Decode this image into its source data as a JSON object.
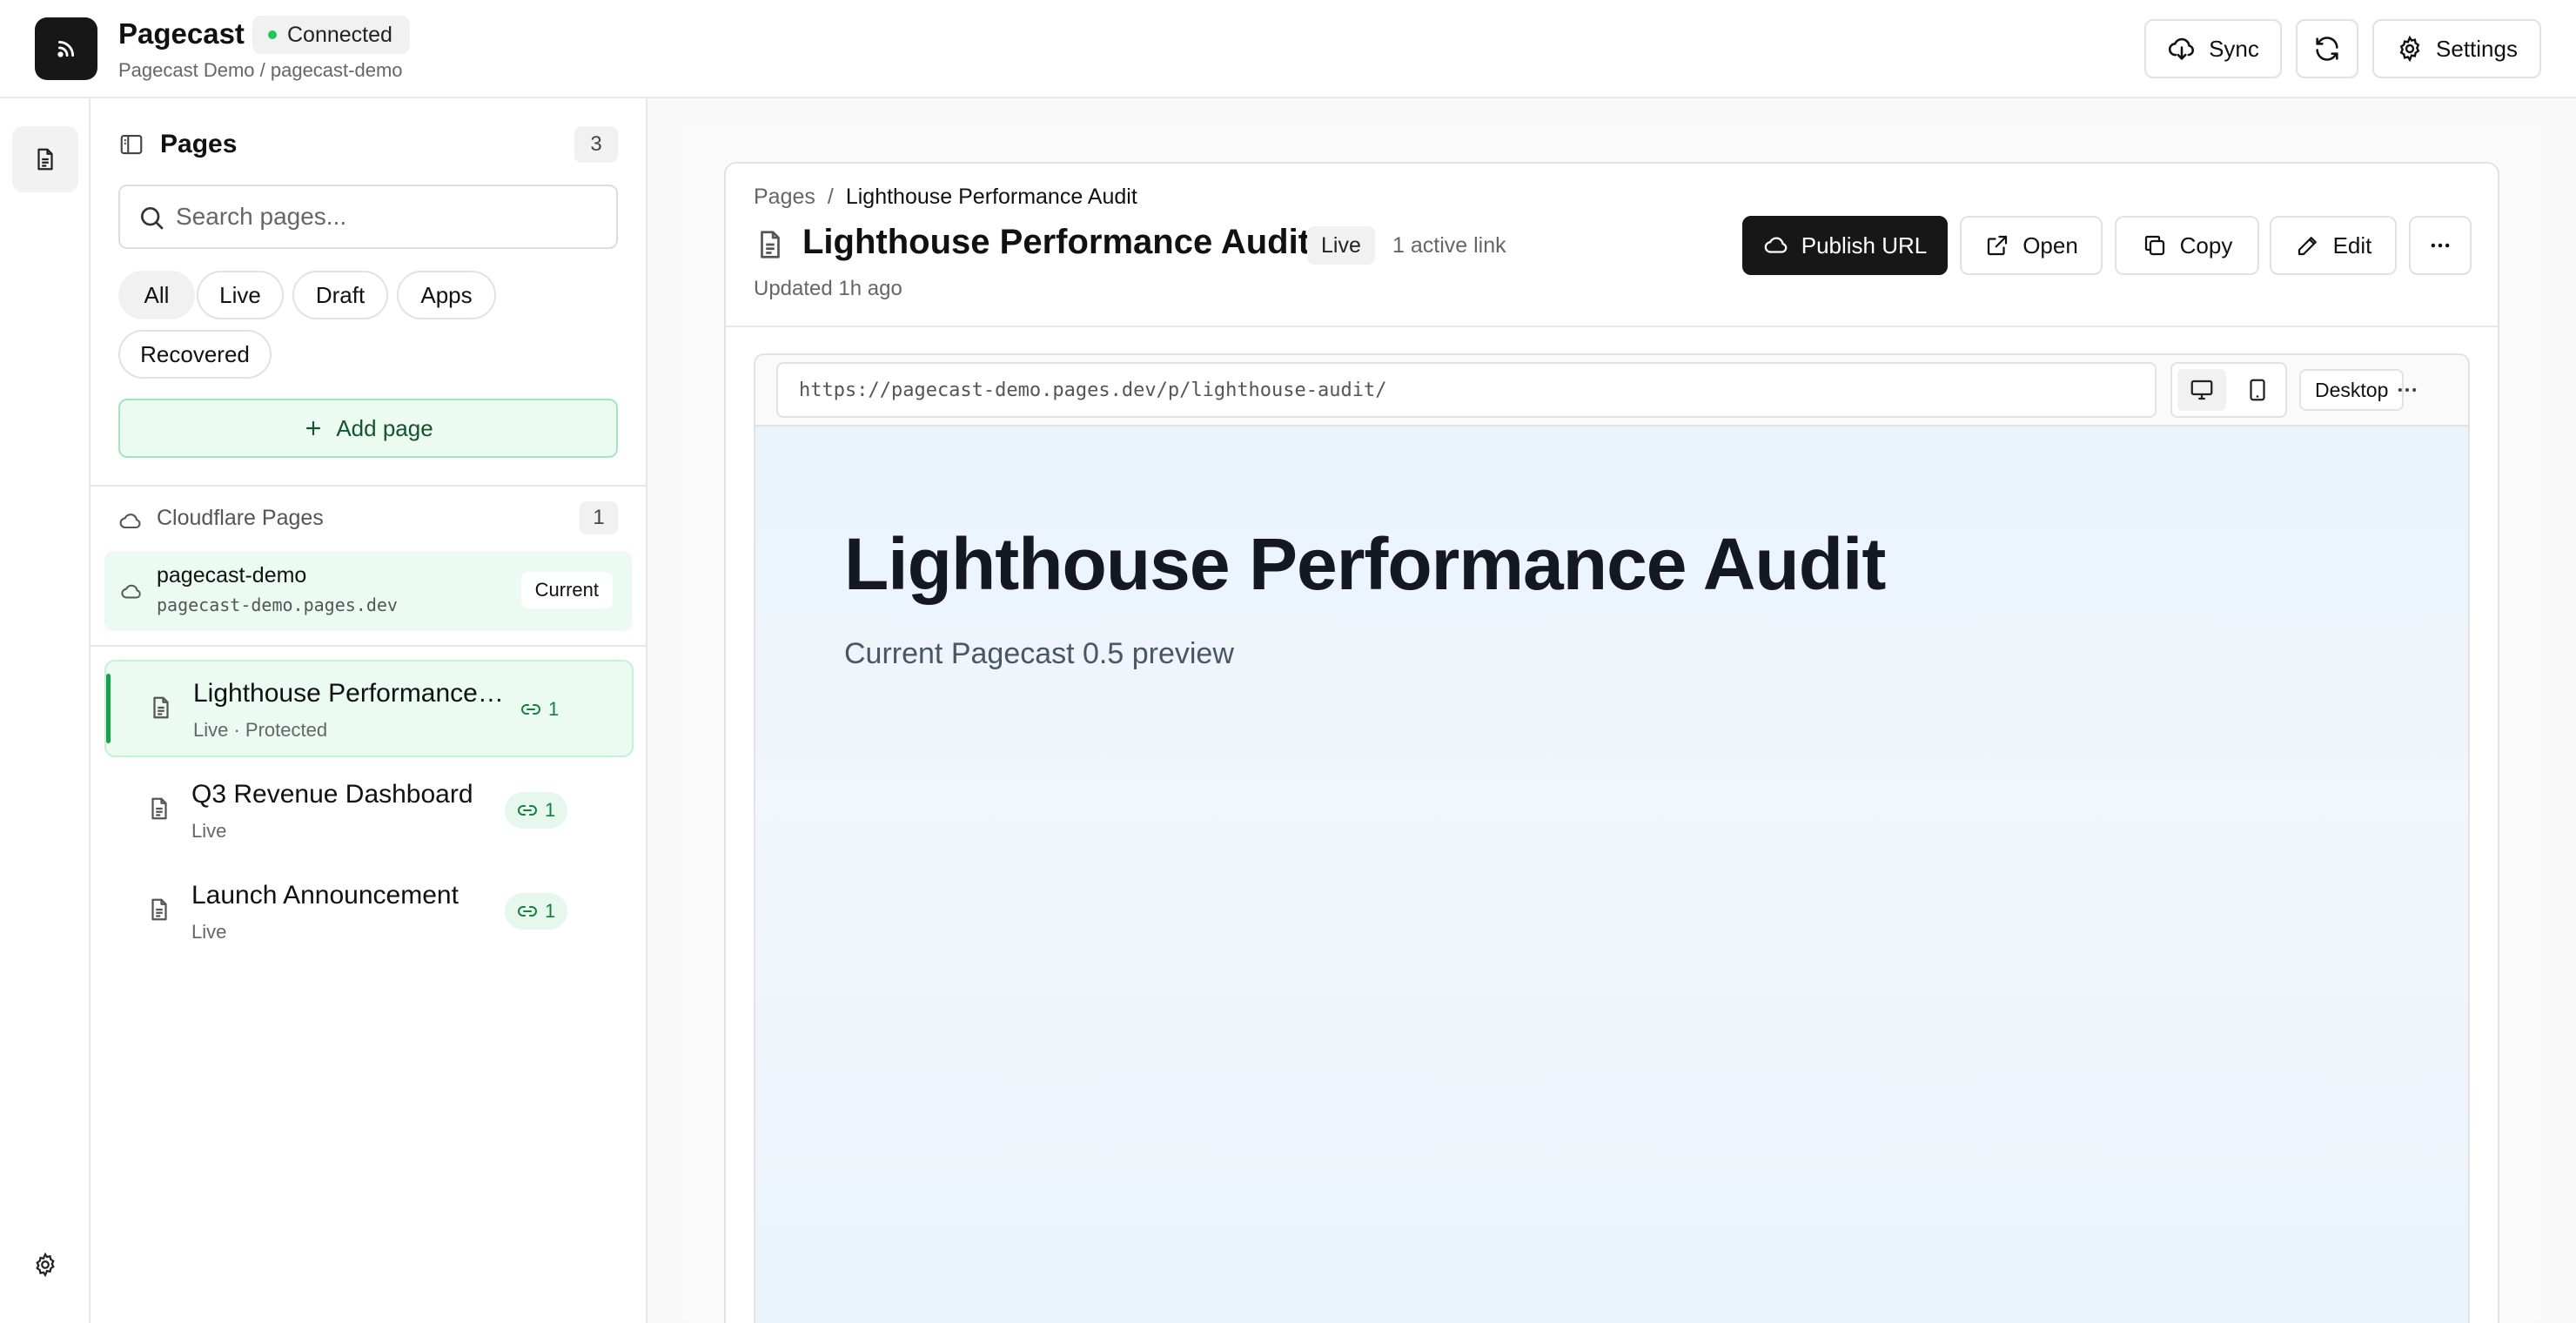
{
  "header": {
    "app_title": "Pagecast",
    "status": "Connected",
    "subtitle": "Pagecast Demo / pagecast-demo",
    "sync_label": "Sync",
    "settings_label": "Settings"
  },
  "sidebar": {
    "title": "Pages",
    "count": "3",
    "search_placeholder": "Search pages...",
    "filters": [
      "All",
      "Live",
      "Draft",
      "Apps",
      "Recovered"
    ],
    "add_page_label": "Add page",
    "cloudflare": {
      "label": "Cloudflare Pages",
      "count": "1",
      "project_name": "pagecast-demo",
      "project_url": "pagecast-demo.pages.dev",
      "badge": "Current"
    },
    "pages": [
      {
        "title": "Lighthouse Performance Audit",
        "subtitle": "Live · Protected",
        "links": "1"
      },
      {
        "title": "Q3 Revenue Dashboard",
        "subtitle": "Live",
        "links": "1"
      },
      {
        "title": "Launch Announcement",
        "subtitle": "Live",
        "links": "1"
      }
    ]
  },
  "main": {
    "breadcrumb_root": "Pages",
    "breadcrumb_sep": "/",
    "breadcrumb_current": "Lighthouse Performance Audit",
    "title": "Lighthouse Performance Audit",
    "status_badge": "Live",
    "active_links": "1 active link",
    "updated": "Updated 1h ago",
    "buttons": {
      "publish": "Publish URL",
      "open": "Open",
      "copy": "Copy",
      "edit": "Edit"
    },
    "preview": {
      "url": "https://pagecast-demo.pages.dev/p/lighthouse-audit/",
      "mode": "Desktop",
      "heading": "Lighthouse Performance Audit",
      "subheading": "Current Pagecast 0.5 preview"
    }
  },
  "colors": {
    "accent_green": "#16a34a",
    "light_green_bg": "#ecfbf2",
    "dark_button": "#171717"
  }
}
